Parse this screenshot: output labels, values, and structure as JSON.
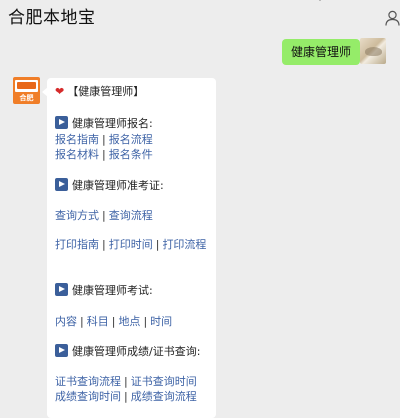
{
  "header": {
    "title": "合肥本地宝"
  },
  "outgoing": {
    "text": "健康管理师"
  },
  "avatar_logo": {
    "text": "合肥"
  },
  "card": {
    "heading": "【健康管理师】",
    "sections": [
      {
        "title": "健康管理师报名:",
        "rows": [
          [
            "报名指南",
            "报名流程"
          ],
          [
            "报名材料",
            "报名条件"
          ]
        ]
      },
      {
        "title": "健康管理师准考证:",
        "rows": [
          [
            "查询方式",
            "查询流程"
          ],
          [
            "打印指南",
            "打印时间",
            "打印流程"
          ]
        ]
      },
      {
        "title": "健康管理师考试:",
        "rows": [
          [
            "内容",
            "科目",
            "地点",
            "时间"
          ]
        ]
      },
      {
        "title": "健康管理师成绩/证书查询:",
        "rows": [
          [
            "证书查询流程",
            "证书查询时间"
          ],
          [
            "成绩查询时间",
            "成绩查询流程"
          ]
        ]
      }
    ],
    "separator": "|"
  },
  "colors": {
    "background": "#ededed",
    "outgoing_bubble": "#95ec69",
    "link": "#3e63a6",
    "play_icon": "#3b5f9a",
    "heart": "#d62b2b",
    "logo": "#f07e28"
  }
}
